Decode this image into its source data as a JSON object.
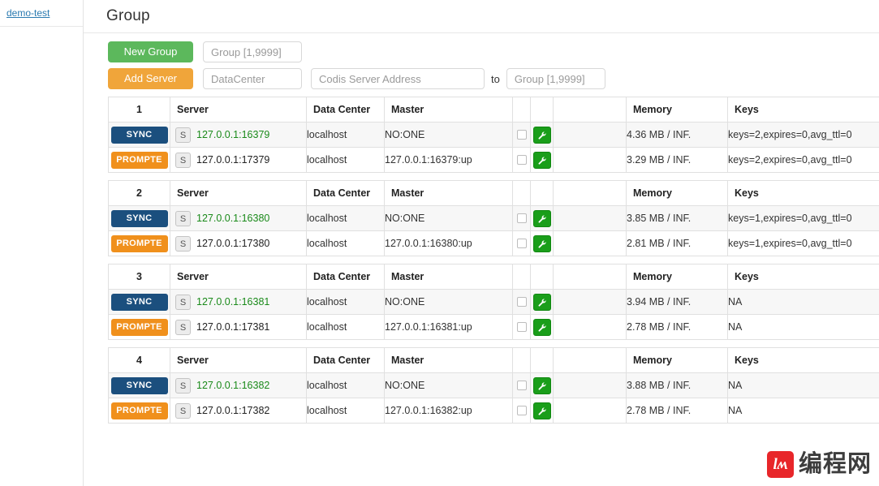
{
  "sidebar": {
    "link_label": "demo-test"
  },
  "header": {
    "title": "Group"
  },
  "toolbar": {
    "new_group_label": "New Group",
    "new_group_placeholder": "Group [1,9999]",
    "new_group_value": "",
    "add_server_label": "Add Server",
    "datacenter_placeholder": "DataCenter",
    "datacenter_value": "",
    "address_placeholder": "Codis Server Address",
    "address_value": "",
    "to_label": "to",
    "to_group_placeholder": "Group [1,9999]",
    "to_group_value": ""
  },
  "columns": {
    "server": "Server",
    "data_center": "Data Center",
    "master": "Master",
    "blank1": "",
    "blank2": "",
    "blank3": "",
    "memory": "Memory",
    "keys": "Keys"
  },
  "icons": {
    "s_tag": "S",
    "wrench": "wrench-icon",
    "checkbox": "checkbox-icon"
  },
  "colors": {
    "sync_badge": "#1b4f7e",
    "prompte_badge": "#f0901c",
    "new_group_button": "#5cb85c",
    "add_server_button": "#f0a53a",
    "wrench_button": "#1a9e1a",
    "master_address_text": "#1a8a1a",
    "sidebar_link": "#2a7ab0"
  },
  "groups": [
    {
      "id": "1",
      "rows": [
        {
          "action": "SYNC",
          "action_type": "sync",
          "stag": "S",
          "server": "127.0.0.1:16379",
          "is_master": true,
          "data_center": "localhost",
          "master": "NO:ONE",
          "memory": "4.36 MB / INF.",
          "keys": "keys=2,expires=0,avg_ttl=0"
        },
        {
          "action": "PROMPTE",
          "action_type": "prompte",
          "stag": "S",
          "server": "127.0.0.1:17379",
          "is_master": false,
          "data_center": "localhost",
          "master": "127.0.0.1:16379:up",
          "memory": "3.29 MB / INF.",
          "keys": "keys=2,expires=0,avg_ttl=0"
        }
      ]
    },
    {
      "id": "2",
      "rows": [
        {
          "action": "SYNC",
          "action_type": "sync",
          "stag": "S",
          "server": "127.0.0.1:16380",
          "is_master": true,
          "data_center": "localhost",
          "master": "NO:ONE",
          "memory": "3.85 MB / INF.",
          "keys": "keys=1,expires=0,avg_ttl=0"
        },
        {
          "action": "PROMPTE",
          "action_type": "prompte",
          "stag": "S",
          "server": "127.0.0.1:17380",
          "is_master": false,
          "data_center": "localhost",
          "master": "127.0.0.1:16380:up",
          "memory": "2.81 MB / INF.",
          "keys": "keys=1,expires=0,avg_ttl=0"
        }
      ]
    },
    {
      "id": "3",
      "rows": [
        {
          "action": "SYNC",
          "action_type": "sync",
          "stag": "S",
          "server": "127.0.0.1:16381",
          "is_master": true,
          "data_center": "localhost",
          "master": "NO:ONE",
          "memory": "3.94 MB / INF.",
          "keys": "NA"
        },
        {
          "action": "PROMPTE",
          "action_type": "prompte",
          "stag": "S",
          "server": "127.0.0.1:17381",
          "is_master": false,
          "data_center": "localhost",
          "master": "127.0.0.1:16381:up",
          "memory": "2.78 MB / INF.",
          "keys": "NA"
        }
      ]
    },
    {
      "id": "4",
      "rows": [
        {
          "action": "SYNC",
          "action_type": "sync",
          "stag": "S",
          "server": "127.0.0.1:16382",
          "is_master": true,
          "data_center": "localhost",
          "master": "NO:ONE",
          "memory": "3.88 MB / INF.",
          "keys": "NA"
        },
        {
          "action": "PROMPTE",
          "action_type": "prompte",
          "stag": "S",
          "server": "127.0.0.1:17382",
          "is_master": false,
          "data_center": "localhost",
          "master": "127.0.0.1:16382:up",
          "memory": "2.78 MB / INF.",
          "keys": "NA"
        }
      ]
    }
  ],
  "watermark": {
    "logo_text": "lʍ",
    "text": "编程网"
  }
}
